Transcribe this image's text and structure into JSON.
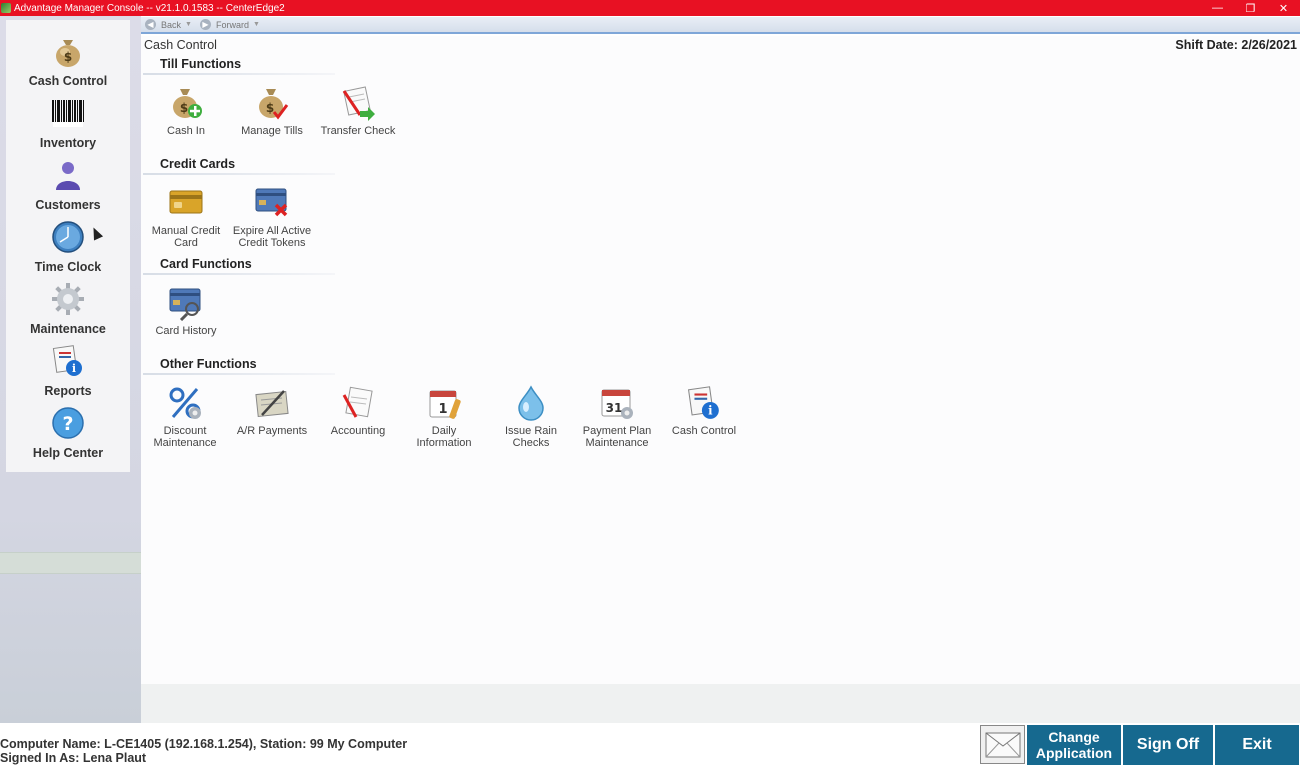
{
  "window": {
    "title": "Advantage Manager Console -- v21.1.0.1583 -- CenterEdge2",
    "minimize_glyph": "—",
    "restore_glyph": "❐",
    "close_glyph": "✕"
  },
  "nav": {
    "back_label": "Back",
    "forward_label": "Forward"
  },
  "sidebar": {
    "items": [
      {
        "label": "Cash Control",
        "icon": "money-bag-icon"
      },
      {
        "label": "Inventory",
        "icon": "barcode-icon"
      },
      {
        "label": "Customers",
        "icon": "person-icon"
      },
      {
        "label": "Time Clock",
        "icon": "clock-icon"
      },
      {
        "label": "Maintenance",
        "icon": "gear-icon"
      },
      {
        "label": "Reports",
        "icon": "report-info-icon"
      },
      {
        "label": "Help Center",
        "icon": "help-icon"
      }
    ]
  },
  "main": {
    "page_title": "Cash Control",
    "shift_date": "Shift Date: 2/26/2021",
    "sections": [
      {
        "title": "Till Functions",
        "items": [
          {
            "label": "Cash In",
            "icon": "money-bag-plus-icon"
          },
          {
            "label": "Manage Tills",
            "icon": "money-bag-check-icon"
          },
          {
            "label": "Transfer Check",
            "icon": "check-transfer-icon"
          }
        ]
      },
      {
        "title": "Credit Cards",
        "items": [
          {
            "label": "Manual Credit\nCard",
            "icon": "gold-card-icon"
          },
          {
            "label": "Expire All Active\nCredit Tokens",
            "icon": "card-delete-icon"
          }
        ]
      },
      {
        "title": "Card Functions",
        "items": [
          {
            "label": "Card History",
            "icon": "card-history-icon"
          }
        ]
      },
      {
        "title": "Other Functions",
        "items": [
          {
            "label": "Discount\nMaintenance",
            "icon": "percent-icon"
          },
          {
            "label": "A/R Payments",
            "icon": "ar-payments-icon"
          },
          {
            "label": "Accounting",
            "icon": "accounting-icon"
          },
          {
            "label": "Daily\nInformation",
            "icon": "calendar-icon"
          },
          {
            "label": "Issue Rain\nChecks",
            "icon": "raindrop-icon"
          },
          {
            "label": "Payment Plan\nMaintenance",
            "icon": "calendar-gear-icon"
          },
          {
            "label": "Cash Control",
            "icon": "report-info-icon"
          }
        ]
      }
    ]
  },
  "status": {
    "computer": "Computer Name: L-CE1405 (192.168.1.254), Station: 99 My Computer",
    "signed_in": "Signed In As: Lena Plaut"
  },
  "buttons": {
    "change_application": "Change\nApplication",
    "sign_off": "Sign Off",
    "exit": "Exit"
  },
  "colors": {
    "titlebar": "#e81123",
    "button": "#16698f"
  }
}
